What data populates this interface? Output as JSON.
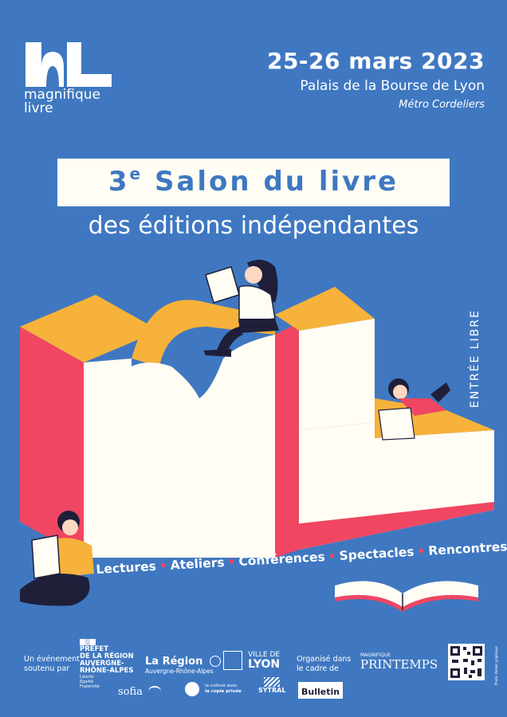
{
  "brand": {
    "logo_text_line1": "magnifique",
    "logo_text_line2": "livre"
  },
  "event": {
    "dates": "25-26 mars 2023",
    "venue": "Palais de la Bourse de Lyon",
    "metro": "Métro Cordeliers",
    "title_number": "3",
    "title_superscript": "e",
    "title": "Salon du livre",
    "subtitle": "des éditions indépendantes",
    "admission": "ENTRÉE LIBRE"
  },
  "activities": [
    "Lectures",
    "Ateliers",
    "Conférences",
    "Spectacles",
    "Rencontres"
  ],
  "footer": {
    "support_line1": "Un événement",
    "support_line2": "soutenu par",
    "prefet_line1": "PRÉFET",
    "prefet_line2": "DE LA RÉGION",
    "prefet_line3": "AUVERGNE-",
    "prefet_line4": "RHÔNE-ALPES",
    "prefet_motto1": "Liberté",
    "prefet_motto2": "Égalité",
    "prefet_motto3": "Fraternité",
    "region_name": "La Région",
    "region_sub": "Auvergne-Rhône-Alpes",
    "ville_line1": "VILLE DE",
    "ville_line2": "LYON",
    "organise_line1": "Organisé dans",
    "organise_line2": "le cadre de",
    "printemps_top": "MAGNIFIQUE",
    "printemps_main": "PRINTEMPS",
    "sofia": "sofia",
    "copie_line1": "la culture avec",
    "copie_line2": "la copie privée",
    "sytral": "SYTRAL",
    "bulletin": "Bulletin",
    "credit": "Photo: Atelier graphique"
  },
  "colors": {
    "background": "#3f78c1",
    "cream": "#fffdf4",
    "yellow": "#f6b23a",
    "red": "#f04662",
    "dark": "#1f1f3a"
  }
}
